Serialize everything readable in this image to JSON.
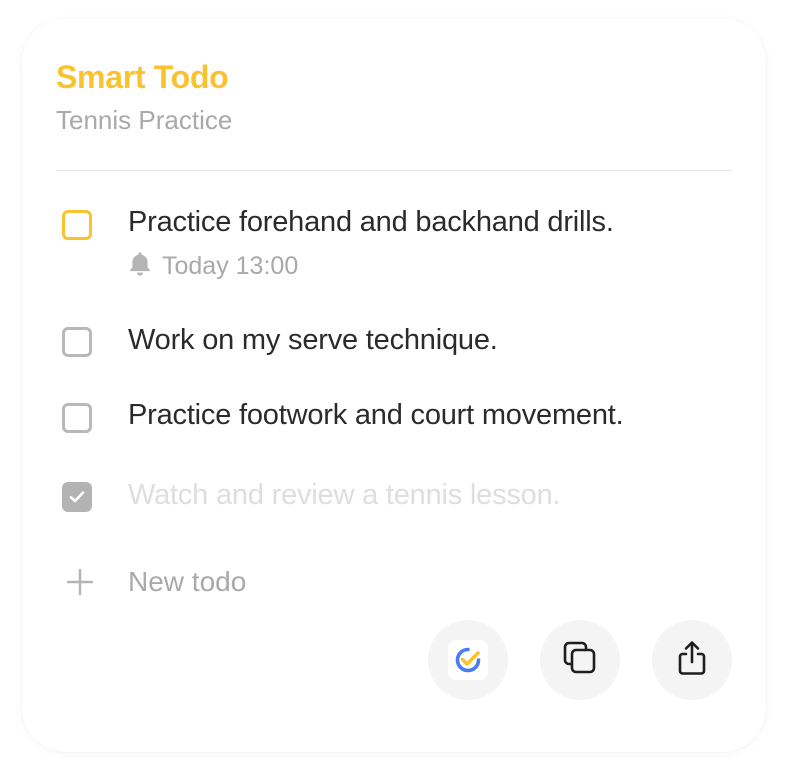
{
  "header": {
    "title": "Smart Todo",
    "subtitle": "Tennis Practice"
  },
  "todos": [
    {
      "text": "Practice forehand and backhand drills.",
      "checked": false,
      "active": true,
      "reminder": "Today 13:00"
    },
    {
      "text": "Work on my serve technique.",
      "checked": false
    },
    {
      "text": "Practice footwork and court movement.",
      "checked": false
    },
    {
      "text": "Watch and review a tennis lesson.",
      "checked": true
    }
  ],
  "new_todo": {
    "placeholder": "New todo"
  },
  "actions": {
    "open_app_icon": "ticktick-app-icon",
    "copy_icon": "copy-icon",
    "share_icon": "share-icon"
  },
  "colors": {
    "accent": "#f9c22e",
    "muted_text": "#a9a9a9",
    "checked_box": "#b3b3b3",
    "done_text": "#dedede",
    "button_bg": "#f4f4f4",
    "brand_blue": "#4a7cf0"
  }
}
